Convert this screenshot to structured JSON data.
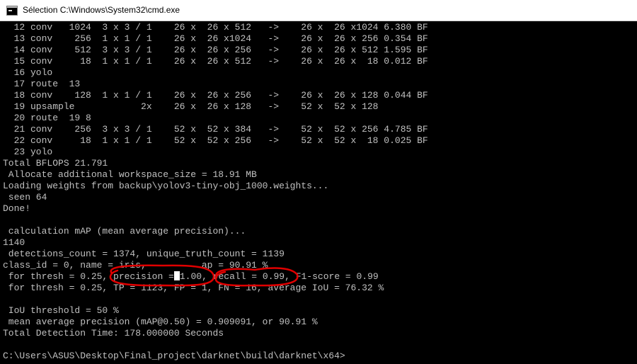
{
  "window": {
    "title": "Sélection C:\\Windows\\System32\\cmd.exe",
    "icon": "cmd-icon"
  },
  "console": {
    "lines": [
      "  12 conv   1024  3 x 3 / 1    26 x  26 x 512   ->    26 x  26 x1024 6.380 BF",
      "  13 conv    256  1 x 1 / 1    26 x  26 x1024   ->    26 x  26 x 256 0.354 BF",
      "  14 conv    512  3 x 3 / 1    26 x  26 x 256   ->    26 x  26 x 512 1.595 BF",
      "  15 conv     18  1 x 1 / 1    26 x  26 x 512   ->    26 x  26 x  18 0.012 BF",
      "  16 yolo",
      "  17 route  13",
      "  18 conv    128  1 x 1 / 1    26 x  26 x 256   ->    26 x  26 x 128 0.044 BF",
      "  19 upsample            2x    26 x  26 x 128   ->    52 x  52 x 128",
      "  20 route  19 8",
      "  21 conv    256  3 x 3 / 1    52 x  52 x 384   ->    52 x  52 x 256 4.785 BF",
      "  22 conv     18  1 x 1 / 1    52 x  52 x 256   ->    52 x  52 x  18 0.025 BF",
      "  23 yolo",
      "Total BFLOPS 21.791",
      " Allocate additional workspace_size = 18.91 MB",
      "Loading weights from backup\\yolov3-tiny-obj_1000.weights...",
      " seen 64",
      "Done!",
      "",
      " calculation mAP (mean average precision)...",
      "1140",
      " detections_count = 1374, unique_truth_count = 1139",
      "class_id = 0, name = iris,          ap = 90.91 %",
      "",
      " for thresh = 0.25, TP = 1123, FP = 1, FN = 16, average IoU = 76.32 %",
      "",
      " IoU threshold = 50 %",
      " mean average precision (mAP@0.50) = 0.909091, or 90.91 %",
      "Total Detection Time: 178.000000 Seconds",
      "",
      "C:\\Users\\ASUS\\Desktop\\Final_project\\darknet\\build\\darknet\\x64>"
    ],
    "thresh_line": {
      "prefix": " for thresh = 0.25, ",
      "precision_a": "precision =",
      "precision_b": "1.00,",
      "recall": "recall = 0.99,",
      "suffix": " F1-score = 0.99"
    }
  },
  "colors": {
    "background": "#000000",
    "text": "#c0c0c0",
    "annotation": "#e00000",
    "titlebar": "#ffffff"
  }
}
